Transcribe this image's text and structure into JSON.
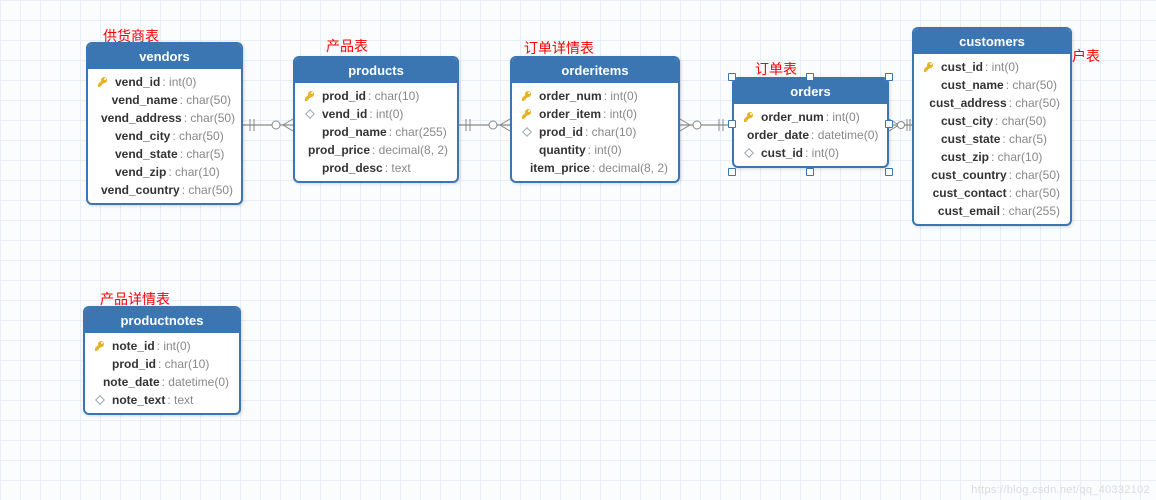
{
  "annotations": {
    "vendors": "供货商表",
    "products": "产品表",
    "orderitems": "订单详情表",
    "orders": "订单表",
    "customers": "用户表",
    "productnotes": "产品详情表"
  },
  "tables": {
    "vendors": {
      "title": "vendors",
      "columns": [
        {
          "icon": "pk",
          "name": "vend_id",
          "type": "int(0)"
        },
        {
          "icon": "",
          "name": "vend_name",
          "type": "char(50)"
        },
        {
          "icon": "",
          "name": "vend_address",
          "type": "char(50)"
        },
        {
          "icon": "",
          "name": "vend_city",
          "type": "char(50)"
        },
        {
          "icon": "",
          "name": "vend_state",
          "type": "char(5)"
        },
        {
          "icon": "",
          "name": "vend_zip",
          "type": "char(10)"
        },
        {
          "icon": "",
          "name": "vend_country",
          "type": "char(50)"
        }
      ]
    },
    "products": {
      "title": "products",
      "columns": [
        {
          "icon": "pk",
          "name": "prod_id",
          "type": "char(10)"
        },
        {
          "icon": "fk",
          "name": "vend_id",
          "type": "int(0)"
        },
        {
          "icon": "",
          "name": "prod_name",
          "type": "char(255)"
        },
        {
          "icon": "",
          "name": "prod_price",
          "type": "decimal(8, 2)"
        },
        {
          "icon": "",
          "name": "prod_desc",
          "type": "text"
        }
      ]
    },
    "orderitems": {
      "title": "orderitems",
      "columns": [
        {
          "icon": "pk",
          "name": "order_num",
          "type": "int(0)"
        },
        {
          "icon": "pk",
          "name": "order_item",
          "type": "int(0)"
        },
        {
          "icon": "fk",
          "name": "prod_id",
          "type": "char(10)"
        },
        {
          "icon": "",
          "name": "quantity",
          "type": "int(0)"
        },
        {
          "icon": "",
          "name": "item_price",
          "type": "decimal(8, 2)"
        }
      ]
    },
    "orders": {
      "title": "orders",
      "columns": [
        {
          "icon": "pk",
          "name": "order_num",
          "type": "int(0)"
        },
        {
          "icon": "",
          "name": "order_date",
          "type": "datetime(0)"
        },
        {
          "icon": "fk",
          "name": "cust_id",
          "type": "int(0)"
        }
      ]
    },
    "customers": {
      "title": "customers",
      "columns": [
        {
          "icon": "pk",
          "name": "cust_id",
          "type": "int(0)"
        },
        {
          "icon": "",
          "name": "cust_name",
          "type": "char(50)"
        },
        {
          "icon": "",
          "name": "cust_address",
          "type": "char(50)"
        },
        {
          "icon": "",
          "name": "cust_city",
          "type": "char(50)"
        },
        {
          "icon": "",
          "name": "cust_state",
          "type": "char(5)"
        },
        {
          "icon": "",
          "name": "cust_zip",
          "type": "char(10)"
        },
        {
          "icon": "",
          "name": "cust_country",
          "type": "char(50)"
        },
        {
          "icon": "",
          "name": "cust_contact",
          "type": "char(50)"
        },
        {
          "icon": "",
          "name": "cust_email",
          "type": "char(255)"
        }
      ]
    },
    "productnotes": {
      "title": "productnotes",
      "columns": [
        {
          "icon": "pk",
          "name": "note_id",
          "type": "int(0)"
        },
        {
          "icon": "",
          "name": "prod_id",
          "type": "char(10)"
        },
        {
          "icon": "",
          "name": "note_date",
          "type": "datetime(0)"
        },
        {
          "icon": "fk",
          "name": "note_text",
          "type": "text"
        }
      ]
    }
  },
  "watermark": "https://blog.csdn.net/qq_40332102",
  "colors": {
    "header_bg": "#3b76b3",
    "annotation": "#ff0000",
    "border": "#3b76b3"
  }
}
